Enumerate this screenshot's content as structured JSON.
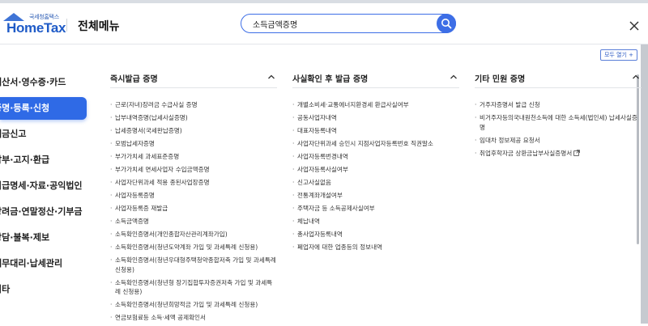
{
  "header": {
    "logo_sub": "국세청홈택스",
    "logo_text": "HomeTax",
    "menu_title": "전체메뉴",
    "search_value": "소득금액증명",
    "search_icon": "search-icon",
    "close_icon": "close-icon"
  },
  "expand_all_label": "모두 열기 +",
  "sidebar": {
    "items": [
      {
        "label": "계산서·영수증·카드",
        "active": false
      },
      {
        "label": "증명·등록·신청",
        "active": true
      },
      {
        "label": "세금신고",
        "active": false
      },
      {
        "label": "납부·고지·환급",
        "active": false
      },
      {
        "label": "지급명세·자료·공익법인",
        "active": false
      },
      {
        "label": "장려금·연말정산·기부금",
        "active": false
      },
      {
        "label": "상담·불복·제보",
        "active": false
      },
      {
        "label": "세무대리·납세관리",
        "active": false
      },
      {
        "label": "기타",
        "active": false
      }
    ]
  },
  "columns": [
    {
      "title": "즉시발급 증명",
      "items": [
        "근로(자녀)장려금 수급사실 증명",
        "납부내역증명(납세사실증명)",
        "납세증명서(국세완납증명)",
        "모범납세자증명",
        "부가가치세 과세표준증명",
        "부가가치세 면세사업자 수입금액증명",
        "사업자단위과세 적용 종된사업장증명",
        "사업자등록증명",
        "사업자등록증 재발급",
        "소득금액증명",
        "소득확인증명서(개인종합자산관리계좌가입)",
        "소득확인증명서(청년도약계좌 가입 및 과세특례 신청용)",
        "소득확인증명서(청년우대형주택청약종합저축 가입 및 과세특례 신청용)",
        "소득확인증명서(청년형 장기집합투자증권저축 가입 및 과세특례 신청용)",
        "소득확인증명서(청년희망적금 가입 및 과세특례 신청용)",
        "연금보험료등 소득·세액 공제확인서"
      ]
    },
    {
      "title": "사실확인 후 발급 증명",
      "items": [
        "개별소비세·교통에너지환경세 환급사실여부",
        "공동사업자내역",
        "대표자등록내역",
        "사업자단위과세 승인시 지점사업자등록번호 직권말소",
        "사업자등록번경내역",
        "사업자등록사실여부",
        "신고사실없음",
        "전통계좌개설여부",
        "주택자금 등 소득공제사실여부",
        "체납내역",
        "총사업자등록내역",
        "폐업자에 대한 업종등의 정보내역"
      ]
    },
    {
      "title": "기타 민원 증명",
      "items": [
        "거주자증명서 발급 신청",
        "비거주자등의국내원천소득에 대한 소득세(법인세) 납세사실증명",
        "임대차 정보제공 요청서",
        "취업후학자금 상환금납부사실증명서"
      ]
    }
  ],
  "colors": {
    "accent": "#2f6ae6",
    "logo_blue": "#1f5bc7"
  }
}
